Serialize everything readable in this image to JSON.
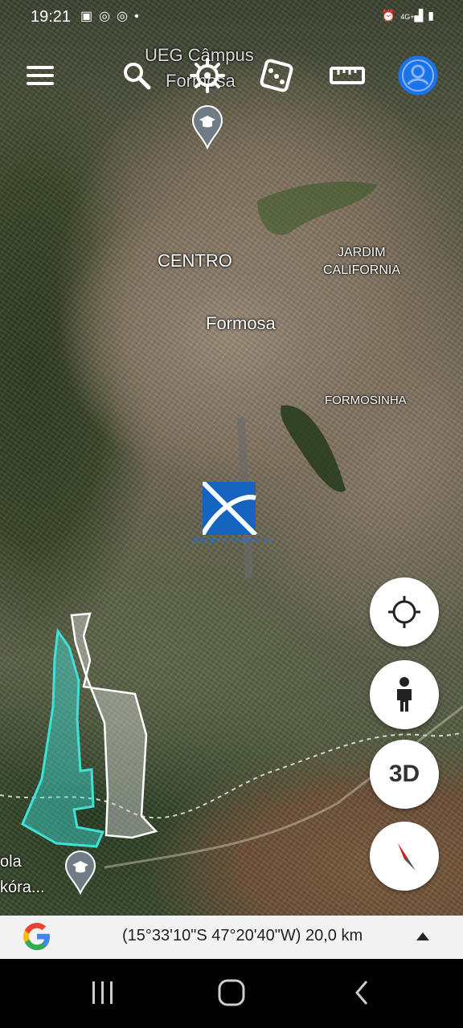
{
  "status_bar": {
    "time": "19:21",
    "left_icons": [
      "image-icon",
      "instagram-icon",
      "instagram-icon",
      "dot-icon"
    ],
    "right_icons": [
      "alarm-icon",
      "4g-icon",
      "signal-icon",
      "battery-charging-icon"
    ],
    "network_label": "4G+"
  },
  "toolbar": {
    "items": [
      "menu-icon",
      "search-icon",
      "voyager-wheel-icon",
      "dice-icon",
      "ruler-icon",
      "account-icon"
    ]
  },
  "map_labels": {
    "search_place_line1": "UEG Câmpus",
    "search_place_line2": "Formosa",
    "centro": "CENTRO",
    "jardim_line1": "JARDIM",
    "jardim_line2": "CALIFORNIA",
    "city": "Formosa",
    "formosinha": "FORMOSINHA",
    "airport_caption": "AEROPORTO BRASÍLIA",
    "bottom_left_line1": "ola",
    "bottom_left_line2": "kóra..."
  },
  "map_buttons": {
    "three_d_label": "3D"
  },
  "bottom_bar": {
    "coordinates": "(15°33'10\"S 47°20'40\"W) 20,0 km"
  },
  "colors": {
    "accent_blue": "#1a73e8",
    "polygon_cyan": "#3fe0d8",
    "polygon_gray": "#d8d8d8",
    "compass_red": "#e53935"
  }
}
